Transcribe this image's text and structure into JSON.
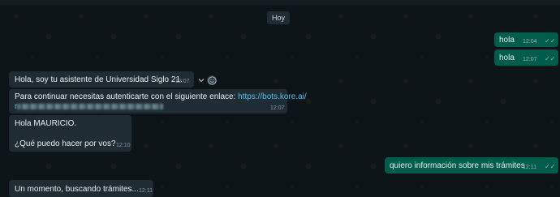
{
  "chat": {
    "date_chip": "Hoy",
    "messages": [
      {
        "direction": "out",
        "text": "hola",
        "time": "12:04"
      },
      {
        "direction": "out",
        "text": "hola",
        "time": "12:07"
      },
      {
        "direction": "in",
        "text": "Hola, soy tu asistente de Universidad Siglo 21.",
        "time": "12:07"
      },
      {
        "direction": "in",
        "text_prefix": "Para continuar necesitas autenticarte con el siguiente enlace: ",
        "link": "https://bots.kore.ai/",
        "link_cont": "r",
        "time": "12:07"
      },
      {
        "direction": "in",
        "line1": "Hola MAURICIO.",
        "line2": "¿Qué puedo hacer por vos?",
        "time": "12:10"
      },
      {
        "direction": "out",
        "text": "quiero información sobre mis trámites",
        "time": "12:11"
      },
      {
        "direction": "in",
        "text": "Un momento, buscando trámites...",
        "time": "12:11"
      }
    ]
  },
  "icons": {
    "read_ticks": "✓✓",
    "chevron": "chevron-down-icon",
    "emoji": "smiley-icon"
  }
}
